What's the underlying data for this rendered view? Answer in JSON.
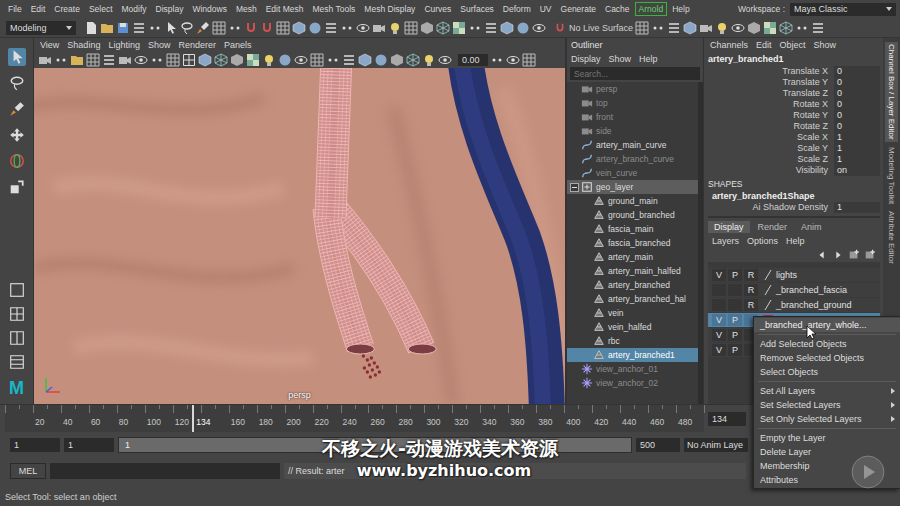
{
  "menubar": {
    "items": [
      {
        "label": "File",
        "highlighted": false
      },
      {
        "label": "Edit",
        "highlighted": false
      },
      {
        "label": "Create",
        "highlighted": false
      },
      {
        "label": "Select",
        "highlighted": false
      },
      {
        "label": "Modify",
        "highlighted": false
      },
      {
        "label": "Display",
        "highlighted": false
      },
      {
        "label": "Windows",
        "highlighted": false
      },
      {
        "label": "Mesh",
        "highlighted": false
      },
      {
        "label": "Edit Mesh",
        "highlighted": false
      },
      {
        "label": "Mesh Tools",
        "highlighted": false
      },
      {
        "label": "Mesh Display",
        "highlighted": false
      },
      {
        "label": "Curves",
        "highlighted": false
      },
      {
        "label": "Surfaces",
        "highlighted": false
      },
      {
        "label": "Deform",
        "highlighted": false
      },
      {
        "label": "UV",
        "highlighted": false
      },
      {
        "label": "Generate",
        "highlighted": false
      },
      {
        "label": "Cache",
        "highlighted": false
      },
      {
        "label": "Arnold",
        "highlighted": true
      },
      {
        "label": "Help",
        "highlighted": false
      }
    ],
    "workspace_label": "Workspace :",
    "workspace": "Maya Classic"
  },
  "toolbar": {
    "mode": "Modeling",
    "live_surface": "No Live Surface"
  },
  "toolbox": {
    "logo": "M"
  },
  "viewport": {
    "menu": [
      "View",
      "Shading",
      "Lighting",
      "Show",
      "Renderer",
      "Panels"
    ],
    "field": "0.00",
    "camera": "persp"
  },
  "outliner": {
    "title": "Outliner",
    "menu": [
      "Display",
      "Show",
      "Help"
    ],
    "search": {
      "placeholder": "Search..."
    },
    "items": [
      {
        "name": "persp",
        "kind": "camera",
        "depth": 0,
        "selected": false,
        "highlighted": false,
        "dimmed": true,
        "expanded": false
      },
      {
        "name": "top",
        "kind": "camera",
        "depth": 0,
        "selected": false,
        "highlighted": false,
        "dimmed": true,
        "expanded": false
      },
      {
        "name": "front",
        "kind": "camera",
        "depth": 0,
        "selected": false,
        "highlighted": false,
        "dimmed": true,
        "expanded": false
      },
      {
        "name": "side",
        "kind": "camera",
        "depth": 0,
        "selected": false,
        "highlighted": false,
        "dimmed": true,
        "expanded": false
      },
      {
        "name": "artery_main_curve",
        "kind": "curve",
        "depth": 0,
        "selected": false,
        "highlighted": false,
        "dimmed": false,
        "expanded": false
      },
      {
        "name": "artery_branch_curve",
        "kind": "curve",
        "depth": 0,
        "selected": false,
        "highlighted": false,
        "dimmed": true,
        "expanded": false
      },
      {
        "name": "vein_curve",
        "kind": "curve",
        "depth": 0,
        "selected": false,
        "highlighted": false,
        "dimmed": true,
        "expanded": false
      },
      {
        "name": "geo_layer",
        "kind": "group",
        "depth": 0,
        "selected": false,
        "highlighted": true,
        "dimmed": false,
        "expanded": true
      },
      {
        "name": "ground_main",
        "kind": "mesh",
        "depth": 1,
        "selected": false,
        "highlighted": false,
        "dimmed": false,
        "expanded": false
      },
      {
        "name": "ground_branched",
        "kind": "mesh",
        "depth": 1,
        "selected": false,
        "highlighted": false,
        "dimmed": false,
        "expanded": false
      },
      {
        "name": "fascia_main",
        "kind": "mesh",
        "depth": 1,
        "selected": false,
        "highlighted": false,
        "dimmed": false,
        "expanded": false
      },
      {
        "name": "fascia_branched",
        "kind": "mesh",
        "depth": 1,
        "selected": false,
        "highlighted": false,
        "dimmed": false,
        "expanded": false
      },
      {
        "name": "artery_main",
        "kind": "mesh",
        "depth": 1,
        "selected": false,
        "highlighted": false,
        "dimmed": false,
        "expanded": false
      },
      {
        "name": "artery_main_halfed",
        "kind": "mesh",
        "depth": 1,
        "selected": false,
        "highlighted": false,
        "dimmed": false,
        "expanded": false
      },
      {
        "name": "artery_branched",
        "kind": "mesh",
        "depth": 1,
        "selected": false,
        "highlighted": false,
        "dimmed": false,
        "expanded": false
      },
      {
        "name": "artery_branched_hal",
        "kind": "mesh",
        "depth": 1,
        "selected": false,
        "highlighted": false,
        "dimmed": false,
        "expanded": false
      },
      {
        "name": "vein",
        "kind": "mesh",
        "depth": 1,
        "selected": false,
        "highlighted": false,
        "dimmed": false,
        "expanded": false
      },
      {
        "name": "vein_halfed",
        "kind": "mesh",
        "depth": 1,
        "selected": false,
        "highlighted": false,
        "dimmed": false,
        "expanded": false
      },
      {
        "name": "rbc",
        "kind": "mesh",
        "depth": 1,
        "selected": false,
        "highlighted": false,
        "dimmed": false,
        "expanded": false
      },
      {
        "name": "artery_branched1",
        "kind": "mesh",
        "depth": 1,
        "selected": true,
        "highlighted": false,
        "dimmed": false,
        "expanded": false
      },
      {
        "name": "view_anchor_01",
        "kind": "locator",
        "depth": 0,
        "selected": false,
        "highlighted": false,
        "dimmed": true,
        "expanded": false
      },
      {
        "name": "view_anchor_02",
        "kind": "locator",
        "depth": 0,
        "selected": false,
        "highlighted": false,
        "dimmed": true,
        "expanded": false
      }
    ]
  },
  "channel_box": {
    "menu": [
      "Channels",
      "Edit",
      "Object",
      "Show"
    ],
    "object": "artery_branched1",
    "channels": [
      {
        "name": "Translate X",
        "value": "0"
      },
      {
        "name": "Translate Y",
        "value": "0"
      },
      {
        "name": "Translate Z",
        "value": "0"
      },
      {
        "name": "Rotate X",
        "value": "0"
      },
      {
        "name": "Rotate Y",
        "value": "0"
      },
      {
        "name": "Rotate Z",
        "value": "0"
      },
      {
        "name": "Scale X",
        "value": "1"
      },
      {
        "name": "Scale Y",
        "value": "1"
      },
      {
        "name": "Scale Z",
        "value": "1"
      },
      {
        "name": "Visibility",
        "value": "on"
      }
    ],
    "shapes_header": "SHAPES",
    "shape": "artery_branched1Shape",
    "shape_attributes": [
      {
        "name": "Ai Shadow Density",
        "value": "1"
      }
    ]
  },
  "layer_editor": {
    "tabs": [
      {
        "label": "Display",
        "selected": true
      },
      {
        "label": "Render",
        "selected": false
      },
      {
        "label": "Anim",
        "selected": false
      }
    ],
    "menu": [
      "Layers",
      "Options",
      "Help"
    ],
    "layers": [
      {
        "flags": [
          "V",
          "P",
          "R"
        ],
        "kind": "plain",
        "name": "lights",
        "selected": false
      },
      {
        "flags": [
          "",
          "",
          "R"
        ],
        "kind": "plain",
        "name": "_branched_fascia",
        "selected": false
      },
      {
        "flags": [
          "",
          "",
          "R"
        ],
        "kind": "plain",
        "name": "_branched_ground",
        "selected": false
      },
      {
        "flags": [
          "V",
          "P",
          ""
        ],
        "kind": "colored",
        "color": "#b3244e",
        "name": "",
        "selected": true
      },
      {
        "flags": [
          "V",
          "P",
          ""
        ],
        "kind": "plain",
        "name": "",
        "selected": false
      },
      {
        "flags": [
          "V",
          "P",
          ""
        ],
        "kind": "plain",
        "name": "",
        "selected": false
      }
    ]
  },
  "context_menu": {
    "items": [
      {
        "kind": "title",
        "label": "_branched_artery_whole...",
        "submenu": false
      },
      {
        "kind": "separator"
      },
      {
        "kind": "item",
        "label": "Add Selected Objects",
        "submenu": false
      },
      {
        "kind": "item",
        "label": "Remove Selected Objects",
        "submenu": false
      },
      {
        "kind": "item",
        "label": "Select Objects",
        "submenu": false
      },
      {
        "kind": "separator"
      },
      {
        "kind": "item",
        "label": "Set All Layers",
        "submenu": true
      },
      {
        "kind": "item",
        "label": "Set Selected Layers",
        "submenu": true
      },
      {
        "kind": "item",
        "label": "Set Only Selected Layers",
        "submenu": true
      },
      {
        "kind": "separator"
      },
      {
        "kind": "item",
        "label": "Empty the Layer",
        "submenu": false
      },
      {
        "kind": "item",
        "label": "Delete Layer",
        "submenu": false
      },
      {
        "kind": "item",
        "label": "Membership",
        "submenu": false
      },
      {
        "kind": "item",
        "label": "Attributes",
        "submenu": false
      }
    ]
  },
  "side_tabs": [
    {
      "label": "Channel Box / Layer Editor",
      "selected": true
    },
    {
      "label": "Modeling Toolkit",
      "selected": false
    },
    {
      "label": "Attribute Editor",
      "selected": false
    }
  ],
  "time_slider": {
    "ticks": [
      "20",
      "40",
      "60",
      "80",
      "100",
      "120",
      "160",
      "180",
      "200",
      "220",
      "240",
      "260",
      "280",
      "300",
      "320",
      "340",
      "360",
      "380",
      "400",
      "420",
      "440",
      "460",
      "480"
    ],
    "max": 500,
    "current": "134",
    "current_level": 0.268,
    "field": "134"
  },
  "range_slider": {
    "start": "1",
    "playback_start": "1",
    "handle": "1",
    "playback_end": "500",
    "anim_layer": "No Anim Laye"
  },
  "command_line": {
    "language": "MEL",
    "result": "// Result: arter"
  },
  "help_line": "Select Tool: select an object",
  "watermark": {
    "title": "不移之火-动漫游戏美术资源",
    "url": "www.byzhihuo.com"
  }
}
